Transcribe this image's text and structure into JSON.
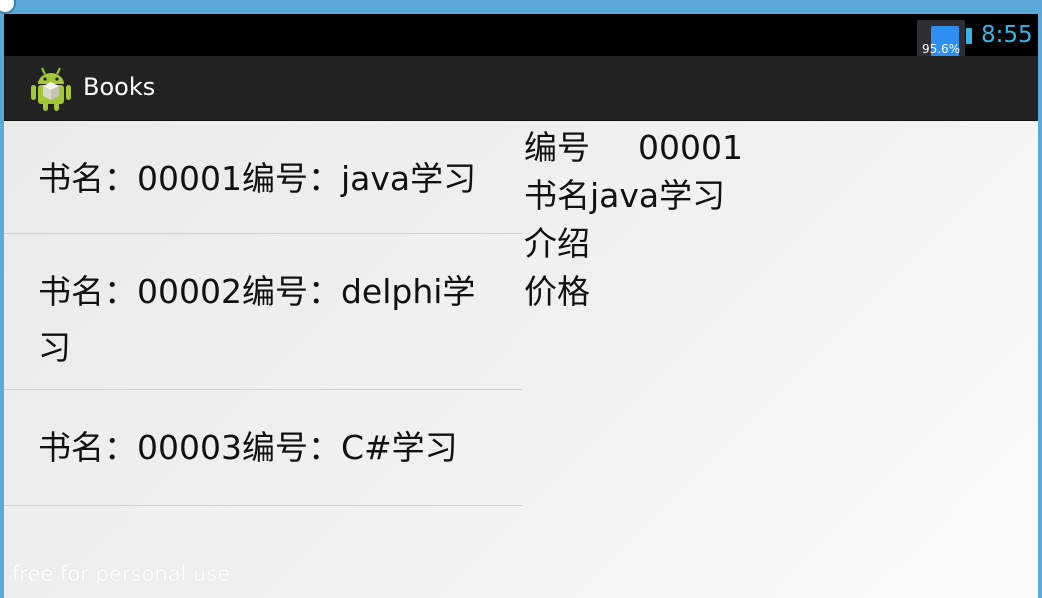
{
  "status_bar": {
    "battery_percent": "95.6%",
    "time": "8:55",
    "clock_color": "#33b5e5"
  },
  "action_bar": {
    "title": "Books",
    "icon": "android-robot-icon"
  },
  "books": [
    {
      "label": "书名：00001编号：java学习"
    },
    {
      "label": "书名：00002编号：delphi学习"
    },
    {
      "label": "书名：00003编号：C#学习"
    }
  ],
  "detail": {
    "id_label": "编号",
    "id_value": "00001",
    "name_label": "书名",
    "name_value": "java学习",
    "intro_label": "介绍",
    "price_label": "价格"
  },
  "watermark": "free for personal use",
  "colors": {
    "accent": "#33b5e5",
    "battery": "#2e8ff0",
    "action_bar": "#222222"
  }
}
